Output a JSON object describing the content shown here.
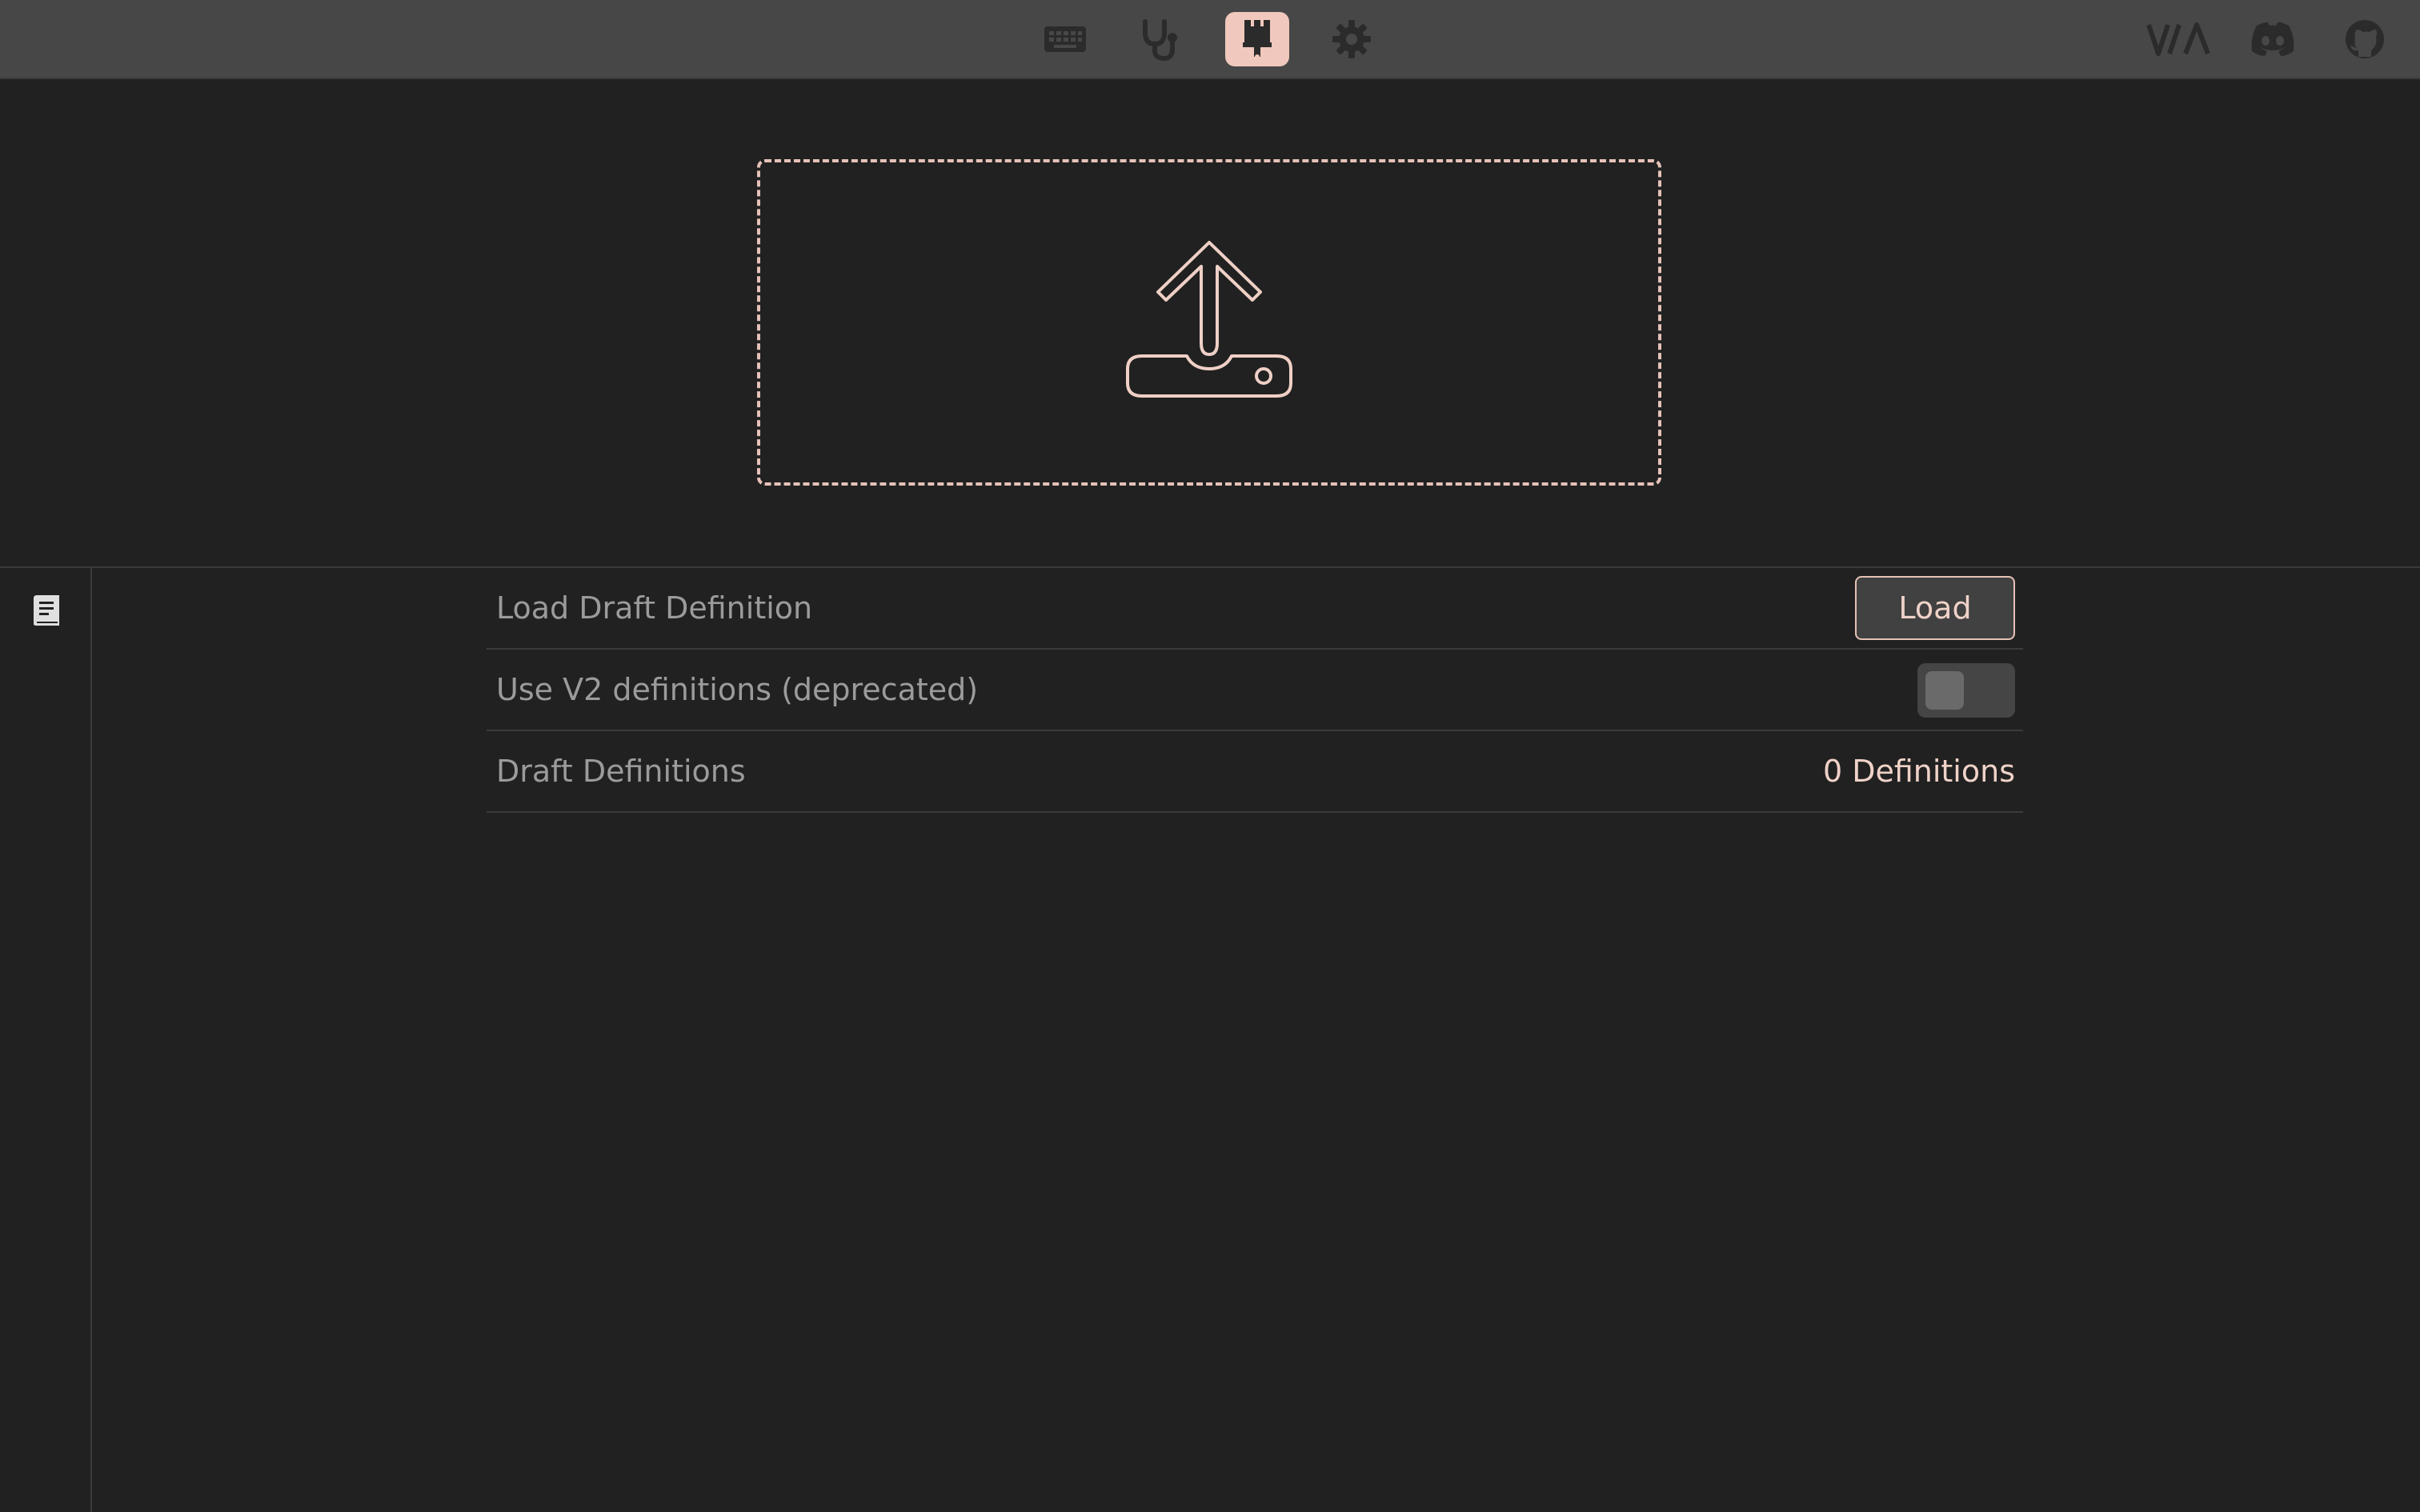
{
  "topbar": {
    "nav_items": [
      {
        "icon": "keyboard-icon",
        "label": "",
        "active": false
      },
      {
        "icon": "stethoscope-icon",
        "label": "",
        "active": false
      },
      {
        "icon": "paintbrush-icon",
        "label": "",
        "active": true
      },
      {
        "icon": "gear-icon",
        "label": "",
        "active": false
      }
    ],
    "external_links": [
      {
        "icon": "via-logo-icon",
        "logo_text": "V/A"
      },
      {
        "icon": "discord-icon"
      },
      {
        "icon": "github-icon"
      }
    ]
  },
  "dropzone": {
    "icon": "upload-icon"
  },
  "sidebar": {
    "icon": "book-icon"
  },
  "settings": {
    "load_draft": {
      "label": "Load Draft Definition",
      "button_label": "Load"
    },
    "use_v2": {
      "label": "Use V2 definitions (deprecated)",
      "enabled": false
    },
    "draft_definitions": {
      "label": "Draft Definitions",
      "value": "0 Definitions"
    }
  },
  "colors": {
    "accent": "#f0c8bd",
    "background": "#212121",
    "topbar": "#474747",
    "muted_icon": "#2b2b2b",
    "label_text": "#9b9b9b"
  }
}
